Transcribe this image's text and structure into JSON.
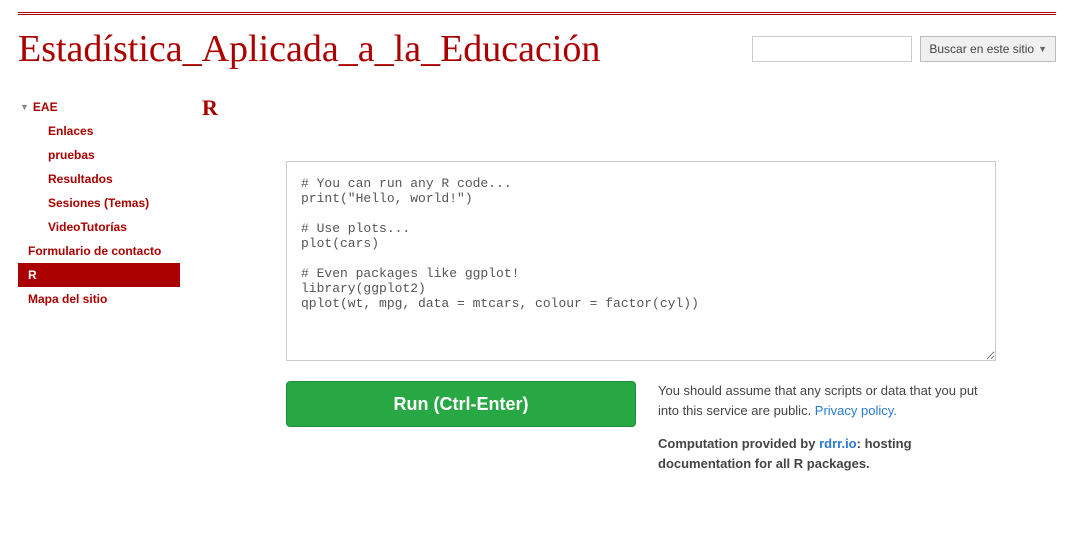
{
  "header": {
    "site_title": "Estadística_Aplicada_a_la_Educación",
    "search_placeholder": "",
    "search_button": "Buscar en este sitio"
  },
  "sidebar": {
    "root": "EAE",
    "children": [
      "Enlaces",
      "pruebas",
      "Resultados",
      "Sesiones (Temas)",
      "VideoTutorías"
    ],
    "items": [
      "Formulario de contacto",
      "R",
      "Mapa del sitio"
    ],
    "active": "R"
  },
  "page": {
    "title": "R"
  },
  "code": {
    "content": "# You can run any R code...\nprint(\"Hello, world!\")\n\n# Use plots...\nplot(cars)\n\n# Even packages like ggplot!\nlibrary(ggplot2)\nqplot(wt, mpg, data = mtcars, colour = factor(cyl))"
  },
  "run": {
    "label": "Run (Ctrl-Enter)"
  },
  "info": {
    "disclaimer_pre": "You should assume that any scripts or data that you put into this service are public. ",
    "privacy_link": "Privacy policy.",
    "provided_pre": "Computation provided by ",
    "provided_link": "rdrr.io",
    "provided_post": ": hosting documentation for all R packages."
  }
}
